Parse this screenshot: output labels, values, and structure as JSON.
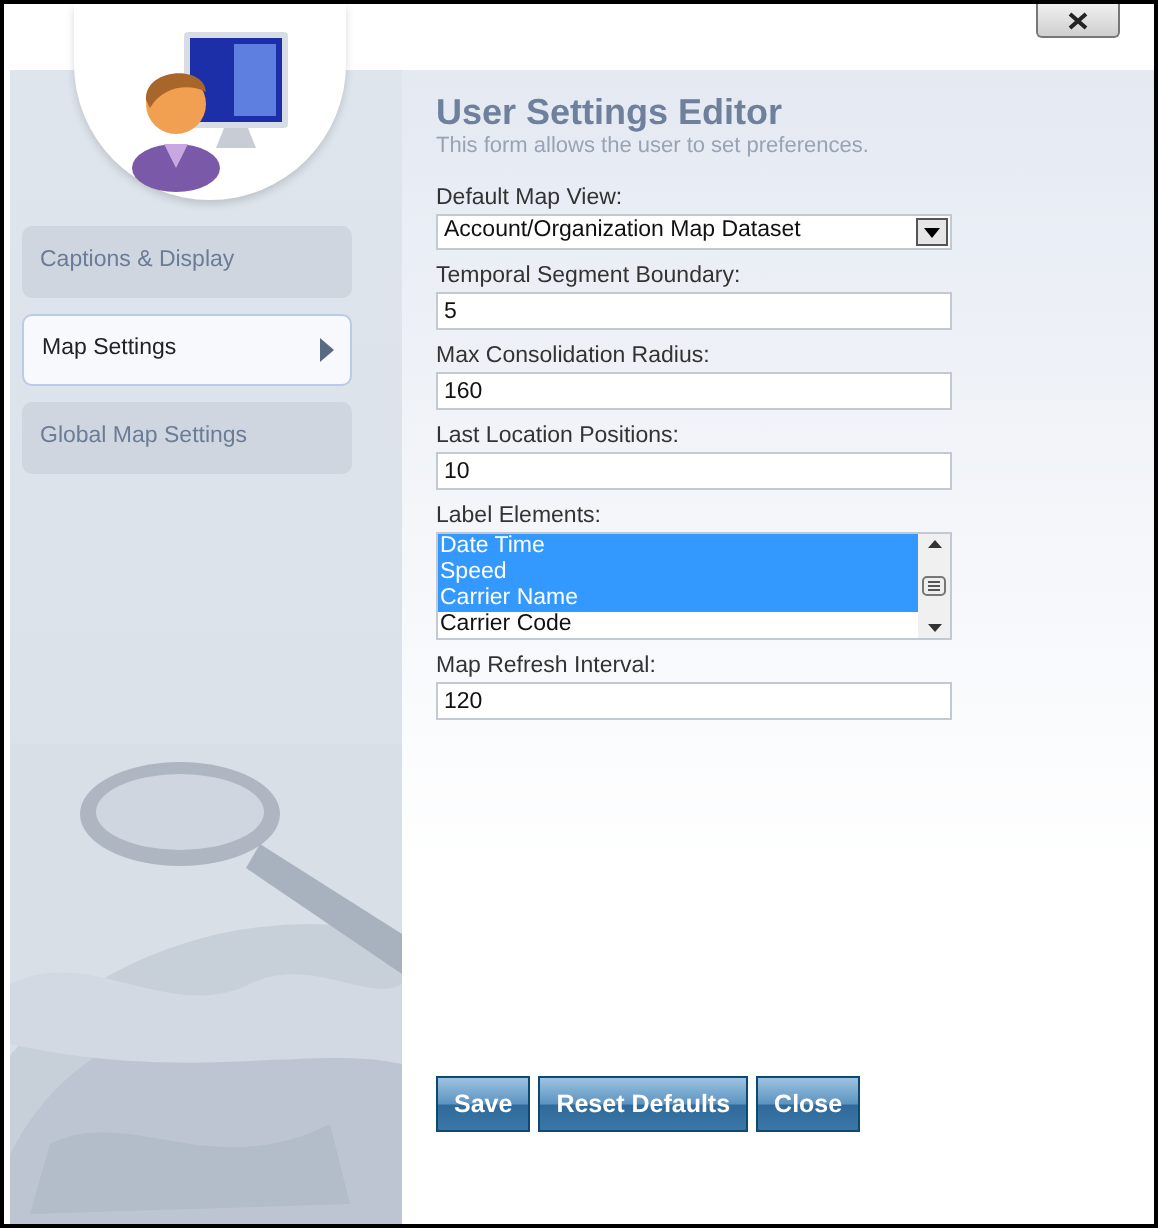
{
  "sidebar": {
    "items": [
      {
        "label": "Captions & Display",
        "selected": false
      },
      {
        "label": "Map Settings",
        "selected": true
      },
      {
        "label": "Global Map Settings",
        "selected": false
      }
    ]
  },
  "header": {
    "title": "User Settings Editor",
    "subtitle": "This form allows the user to set preferences."
  },
  "fields": [
    {
      "kind": "select",
      "label": "Default Map View:",
      "value": "Account/Organization Map Dataset"
    },
    {
      "kind": "text",
      "label": "Temporal Segment Boundary:",
      "value": "5"
    },
    {
      "kind": "text",
      "label": "Max Consolidation Radius:",
      "value": "160"
    },
    {
      "kind": "text",
      "label": "Last Location Positions:",
      "value": "10"
    },
    {
      "kind": "listbox",
      "label": "Label Elements:",
      "options": [
        {
          "label": "Date Time",
          "selected": true
        },
        {
          "label": "Speed",
          "selected": true
        },
        {
          "label": "Carrier Name",
          "selected": true
        },
        {
          "label": "Carrier Code",
          "selected": false
        }
      ]
    },
    {
      "kind": "text",
      "label": "Map Refresh Interval:",
      "value": "120"
    }
  ],
  "buttons": [
    "Save",
    "Reset Defaults",
    "Close"
  ]
}
